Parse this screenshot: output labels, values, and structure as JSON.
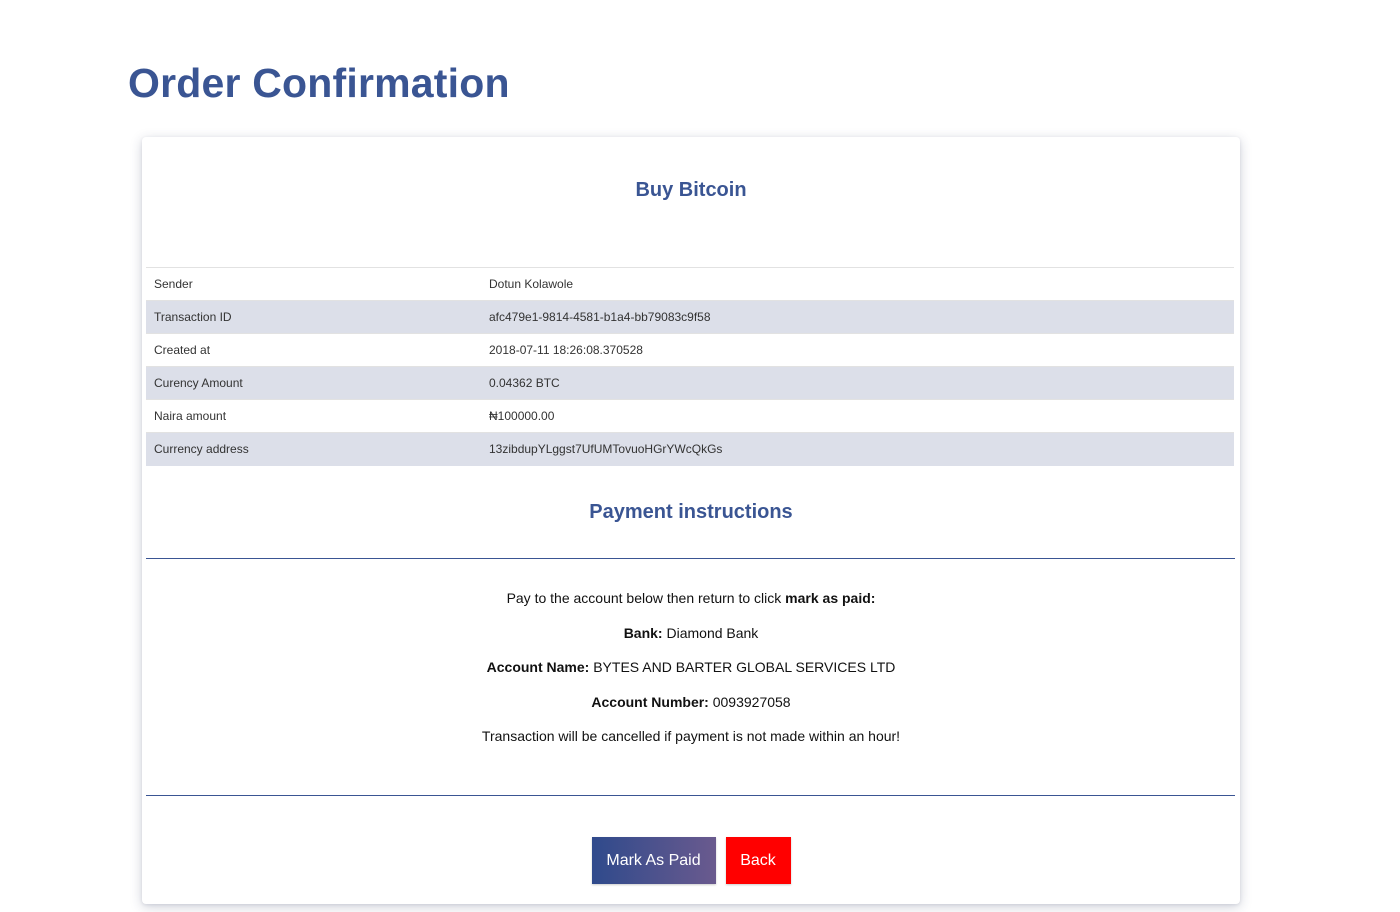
{
  "page": {
    "title": "Order Confirmation"
  },
  "card": {
    "title": "Buy Bitcoin",
    "rows": [
      {
        "label": "Sender",
        "value": "Dotun Kolawole"
      },
      {
        "label": "Transaction ID",
        "value": "afc479e1-9814-4581-b1a4-bb79083c9f58"
      },
      {
        "label": "Created at",
        "value": "2018-07-11 18:26:08.370528"
      },
      {
        "label": "Curency Amount",
        "value": "0.04362 BTC"
      },
      {
        "label": "Naira amount",
        "value": "₦100000.00"
      },
      {
        "label": "Currency address",
        "value": "13zibdupYLggst7UfUMTovuoHGrYWcQkGs"
      }
    ]
  },
  "payment": {
    "title": "Payment instructions",
    "intro_text": "Pay to the account below then return to click",
    "intro_bold": "mark as paid:",
    "bank_label": "Bank:",
    "bank_value": "Diamond Bank",
    "account_name_label": "Account Name:",
    "account_name_value": "BYTES AND BARTER GLOBAL SERVICES LTD",
    "account_number_label": "Account Number:",
    "account_number_value": "0093927058",
    "warning": "Transaction will be cancelled if payment is not made within an hour!"
  },
  "actions": {
    "mark_paid_label": "Mark As Paid",
    "back_label": "Back"
  },
  "colors": {
    "accent": "#3a5593",
    "row_alt": "#dcdfe9",
    "back_button": "#ff0000"
  }
}
